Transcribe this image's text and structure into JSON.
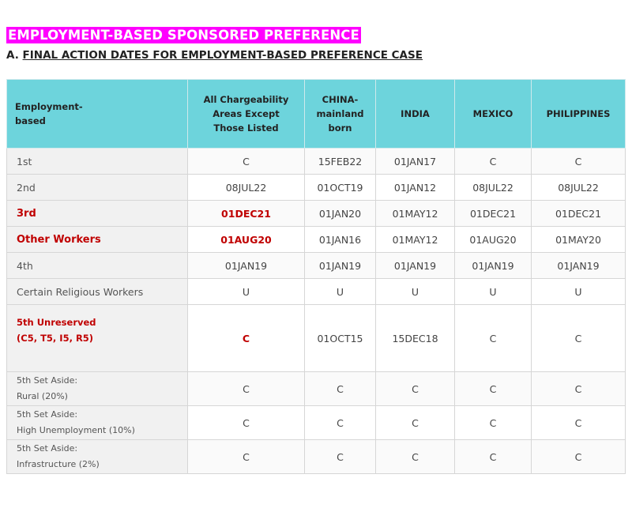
{
  "title": "EMPLOYMENT-BASED SPONSORED PREFERENCE",
  "subtitle": {
    "prefix": "A.",
    "text": "FINAL ACTION DATES FOR EMPLOYMENT-BASED PREFERENCE CASE"
  },
  "table": {
    "headers": {
      "category": [
        "Employment-",
        "based"
      ],
      "all_areas": [
        "All Chargeability",
        "Areas Except",
        "Those Listed"
      ],
      "china": [
        "CHINA-",
        "mainland",
        "born"
      ],
      "india": "INDIA",
      "mexico": "MEXICO",
      "philippines": "PHILIPPINES"
    },
    "rows": [
      {
        "label": [
          "1st"
        ],
        "values": [
          "C",
          "15FEB22",
          "01JAN17",
          "C",
          "C"
        ]
      },
      {
        "label": [
          "2nd"
        ],
        "values": [
          "08JUL22",
          "01OCT19",
          "01JAN12",
          "08JUL22",
          "08JUL22"
        ]
      },
      {
        "label": [
          "3rd"
        ],
        "values": [
          "01DEC21",
          "01JAN20",
          "01MAY12",
          "01DEC21",
          "01DEC21"
        ]
      },
      {
        "label": [
          "Other Workers"
        ],
        "values": [
          "01AUG20",
          "01JAN16",
          "01MAY12",
          "01AUG20",
          "01MAY20"
        ]
      },
      {
        "label": [
          "4th"
        ],
        "values": [
          "01JAN19",
          "01JAN19",
          "01JAN19",
          "01JAN19",
          "01JAN19"
        ]
      },
      {
        "label": [
          "Certain Religious Workers"
        ],
        "values": [
          "U",
          "U",
          "U",
          "U",
          "U"
        ]
      },
      {
        "label": [
          "5th Unreserved",
          "(C5, T5, I5, R5)"
        ],
        "values": [
          "C",
          "01OCT15",
          "15DEC18",
          "C",
          "C"
        ]
      },
      {
        "label": [
          "5th Set Aside:",
          "Rural (20%)"
        ],
        "values": [
          "C",
          "C",
          "C",
          "C",
          "C"
        ]
      },
      {
        "label": [
          "5th Set Aside:",
          "High Unemployment (10%)"
        ],
        "values": [
          "C",
          "C",
          "C",
          "C",
          "C"
        ]
      },
      {
        "label": [
          "5th Set Aside:",
          "Infrastructure  (2%)"
        ],
        "values": [
          "C",
          "C",
          "C",
          "C",
          "C"
        ]
      }
    ]
  },
  "colors": {
    "title_background": "#ff00ff",
    "header_background": "#6dd4dc",
    "highlight_text": "#c00000"
  }
}
